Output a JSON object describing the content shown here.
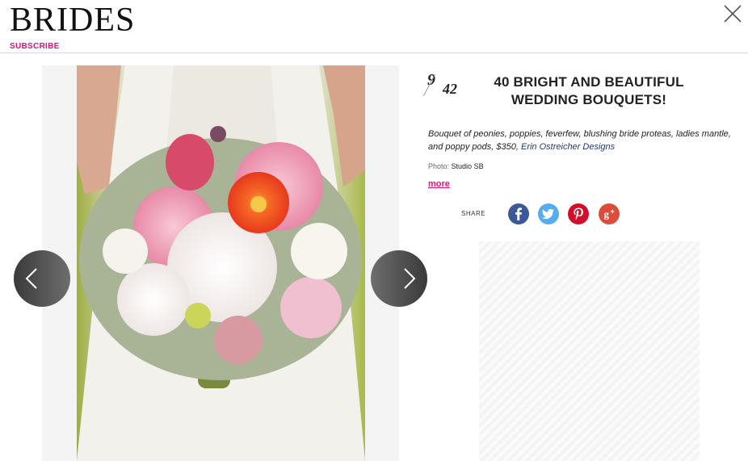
{
  "header": {
    "logo": "BRIDES",
    "subscribe_label": "SUBSCRIBE"
  },
  "gallery": {
    "current": "9",
    "total": "42",
    "title": "40 BRIGHT AND BEAUTIFUL WEDDING BOUQUETS!",
    "caption_text": "Bouquet of peonies, poppies, feverfew, blushing bride proteas, ladies mantle, and poppy pods, $350, ",
    "caption_link": "Erin Ostreicher Designs",
    "credit_label": "Photo:",
    "credit_name": "Studio SB",
    "more_label": "more",
    "share_label": "SHARE"
  },
  "icons": {
    "close": "close-icon",
    "prev": "chevron-left-icon",
    "next": "chevron-right-icon",
    "facebook": "facebook-icon",
    "twitter": "twitter-icon",
    "pinterest": "pinterest-icon",
    "googleplus": "google-plus-icon"
  },
  "colors": {
    "brand_pink": "#e0117a",
    "facebook": "#3b5998",
    "twitter": "#55acee",
    "pinterest": "#d10f2a",
    "googleplus": "#dd4b39",
    "link_blue": "#1f3a73"
  }
}
